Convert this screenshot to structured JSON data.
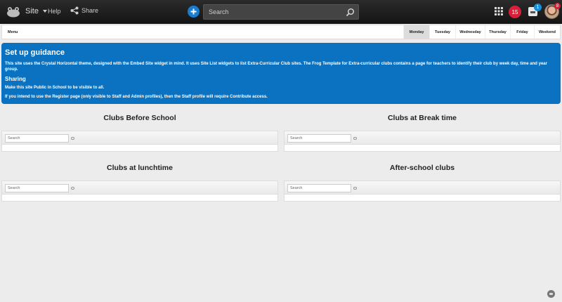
{
  "topbar": {
    "site_label": "Site",
    "help_label": "Help",
    "share_label": "Share",
    "search_placeholder": "Search",
    "notifications_count": "15",
    "inbox_count": "1",
    "avatar_badge": "8"
  },
  "daynav": {
    "menu_label": "Menu",
    "days": [
      "Monday",
      "Tuesday",
      "Wednesday",
      "Thursday",
      "Friday",
      "Weekend"
    ],
    "active_day": "Monday"
  },
  "guidance": {
    "title": "Set up guidance",
    "paragraph1": "This site uses the Crystal Horizontal theme, designed with the Embed Site widget in mind.  It uses Site List widgets to list Extra-Curricular Club sites.  The Frog Template for Extra-curricular clubs contains a page for teachers to identify their club by week day, time and year group.",
    "sharing_heading": "Sharing",
    "paragraph2": "Make this site Public in School to be visible to all.",
    "paragraph3": "If you intend to use the Register page (only visible to Staff and Admin profiles), then the Staff profile will require Contribute access."
  },
  "clubs": [
    {
      "title": "Clubs Before School",
      "search_placeholder": "Search"
    },
    {
      "title": "Clubs at Break time",
      "search_placeholder": "Search"
    },
    {
      "title": "Clubs at lunchtime",
      "search_placeholder": "Search"
    },
    {
      "title": "After-school clubs",
      "search_placeholder": "Search"
    }
  ],
  "colors": {
    "topbar": "#1b1b1b",
    "guidance_bg": "#0a72c0",
    "add_button": "#1a7bd0",
    "notification_badge": "#d81f3a"
  }
}
